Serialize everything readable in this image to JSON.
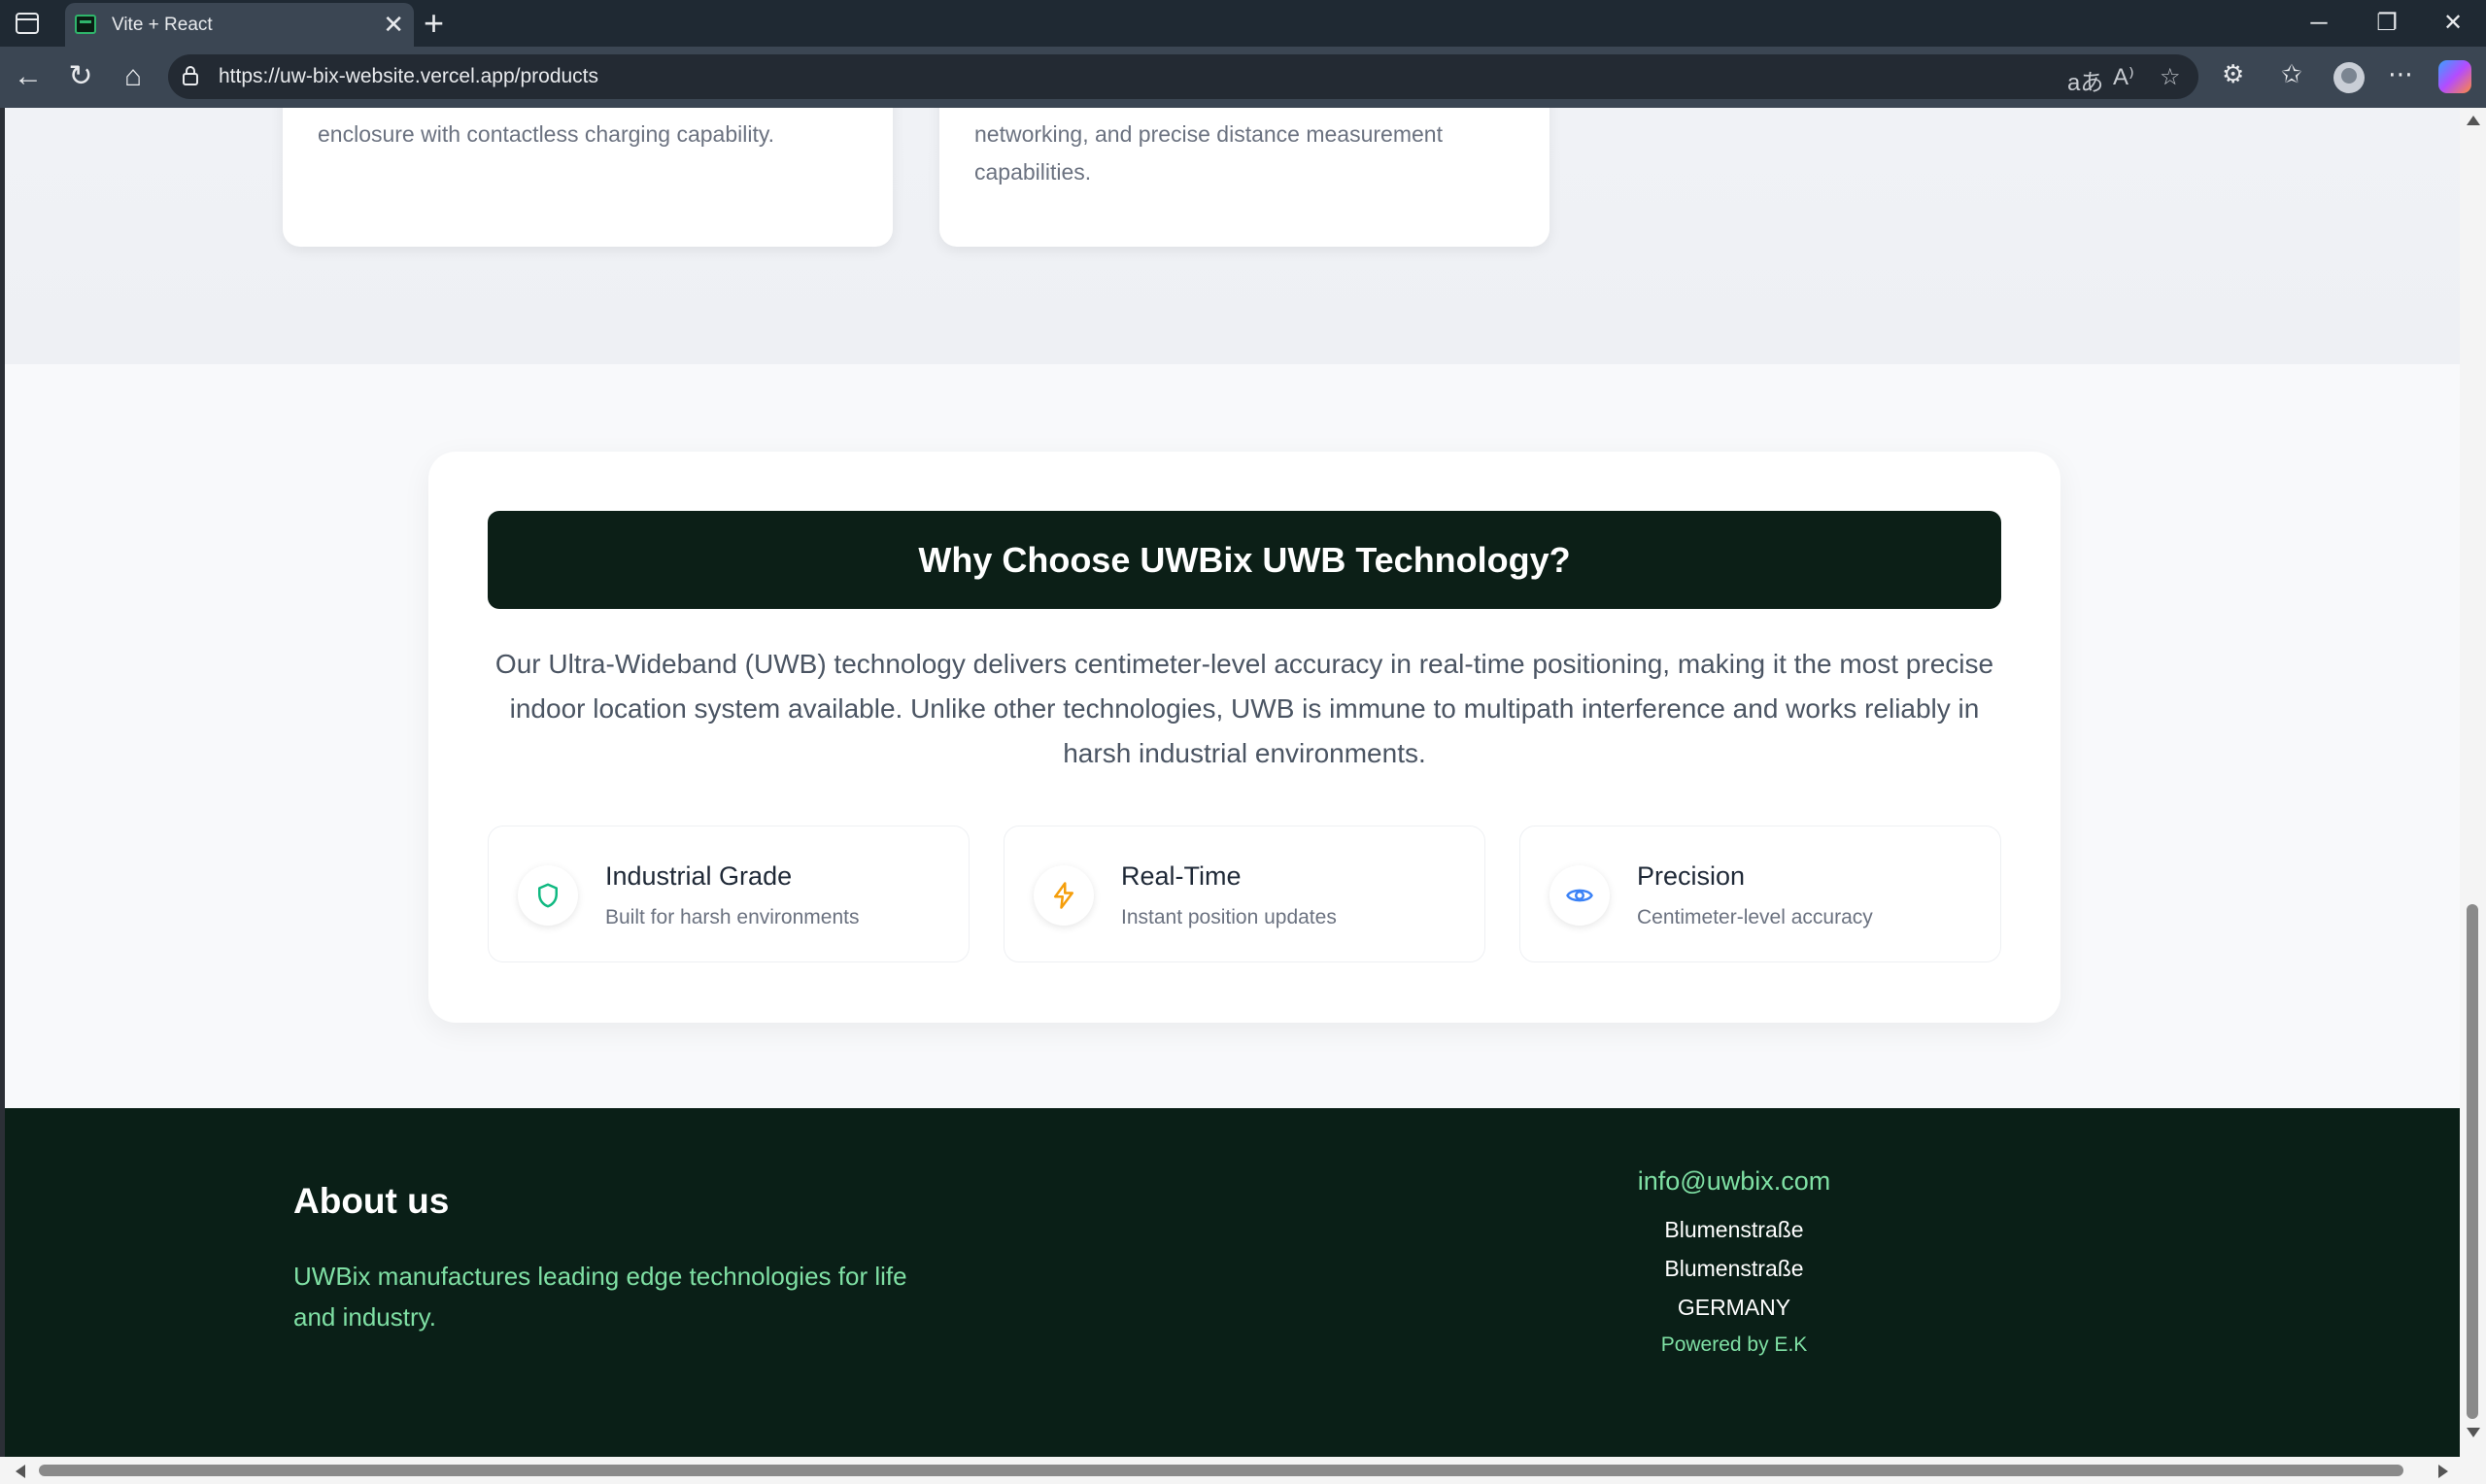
{
  "browser": {
    "tab_title": "Vite + React",
    "tab_close": "✕",
    "new_tab": "+",
    "url": "https://uw-bix-website.vercel.app/products",
    "controls": {
      "minimize": "─",
      "restore": "❐",
      "close": "✕"
    },
    "nav": {
      "back": "←",
      "refresh": "↻",
      "home": "⌂"
    },
    "toolbar": {
      "translate": "aあ",
      "read_aloud": "A⁾",
      "favorite": "☆",
      "extensions": "⚙",
      "favorites": "✩",
      "more": "⋯"
    }
  },
  "products": {
    "cards": [
      {
        "text": "enclosure with contactless charging capability."
      },
      {
        "text": "networking, and precise distance measurement capabilities."
      }
    ]
  },
  "why": {
    "title": "Why Choose UWBix UWB Technology?",
    "description": "Our Ultra-Wideband (UWB) technology delivers centimeter-level accuracy in real-time positioning, making it the most precise indoor location system available. Unlike other technologies, UWB is immune to multipath interference and works reliably in harsh industrial environments.",
    "features": [
      {
        "icon": "shield-icon",
        "title": "Industrial Grade",
        "subtitle": "Built for harsh environments",
        "color": "#10b981"
      },
      {
        "icon": "lightning-icon",
        "title": "Real-Time",
        "subtitle": "Instant position updates",
        "color": "#f59e0b"
      },
      {
        "icon": "eye-icon",
        "title": "Precision",
        "subtitle": "Centimeter-level accuracy",
        "color": "#3b82f6"
      }
    ]
  },
  "footer": {
    "about_title": "About us",
    "about_text": "UWBix manufactures leading edge technologies for life and industry.",
    "email": "info@uwbix.com",
    "address_lines": [
      "Blumenstraße",
      "Blumenstraße",
      "GERMANY"
    ],
    "powered": "Powered by E.K"
  },
  "colors": {
    "footer_bg": "#0a1f17",
    "title_bar_bg": "#0c1f17",
    "accent_green": "#7fe0a4"
  }
}
